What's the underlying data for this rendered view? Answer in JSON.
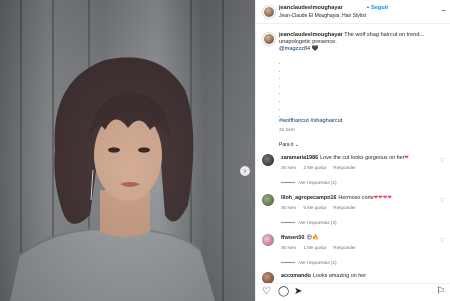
{
  "post": {
    "username": "jeanclaudeelmoughayar",
    "follow_separator": "•",
    "follow_label": "Seguir",
    "subtitle": "Jean-Claude El Moughayar, Hair Stylist",
    "more_label": "..."
  },
  "caption": {
    "username": "jeanclaudeelmoughayar",
    "text_line1": "The wolf shag haircut on trend...",
    "text_line2": "unapologetic presence.",
    "mention": "@magzzz84",
    "mention_suffix": "🖤",
    "dots": [
      ".",
      ".",
      ".",
      ".",
      ".",
      ".",
      ".",
      "."
    ],
    "hashtags": "#wolfhaircut #shaghaircut",
    "time": "31 sem"
  },
  "para_ti": "Para ti ⌄",
  "comments": [
    {
      "username": "zaramaria1986",
      "text": "Love the cut looks gorgeous on her",
      "emoji": "❤",
      "time": "26 sem",
      "likes": "2 Me gusta",
      "reply": "Responder",
      "replies": "Ver respuestas (1)",
      "avatar_color": "#3b3b3b"
    },
    {
      "username": "llloh_agropecampo16",
      "text": "Hermoso corte",
      "emoji": "❤❤❤❤",
      "time": "30 sem",
      "likes": "5 Me gusta",
      "reply": "Responder",
      "replies": "Ver respuestas (3)",
      "avatar_color": "#5c7a4a"
    },
    {
      "username": "ffwoen50",
      "text": "😍🔥",
      "emoji": "",
      "time": "30 sem",
      "likes": "1 Me gusta",
      "reply": "Responder",
      "replies": "Ver respuestas (1)",
      "avatar_color": "#c98fb0"
    },
    {
      "username": "accomando",
      "text": "Looks amazing on her",
      "emoji": "",
      "time": "",
      "likes": "",
      "reply": "",
      "replies": "",
      "avatar_color": "#9a6b4f"
    }
  ],
  "icons": {
    "like": "♡",
    "comment": "◯",
    "share": "➤",
    "save": "⚐",
    "comment_like": "♡",
    "next": "›"
  }
}
